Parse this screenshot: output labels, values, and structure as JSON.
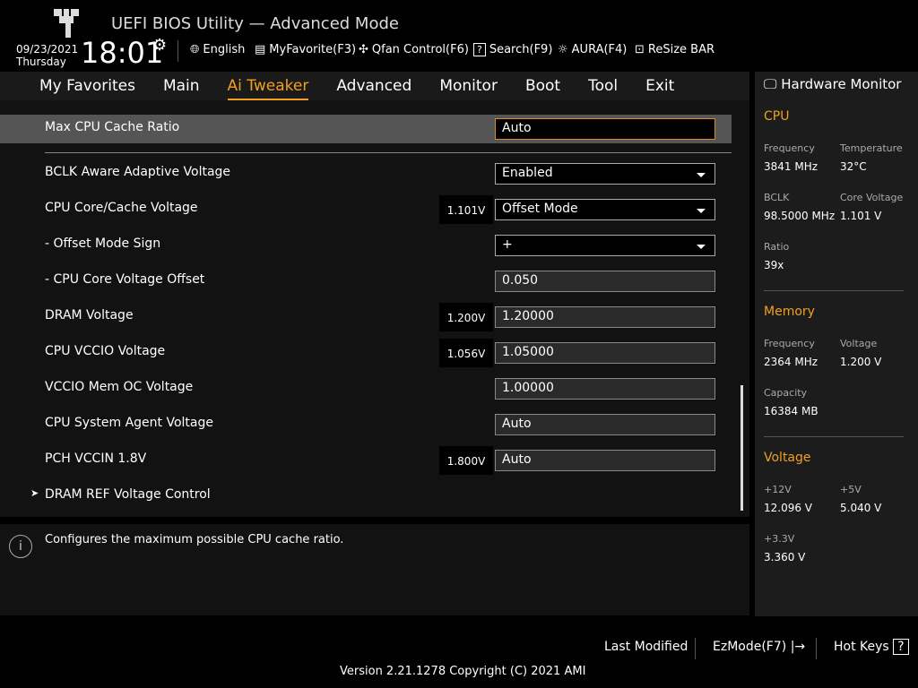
{
  "header": {
    "title": "UEFI BIOS Utility — Advanced Mode",
    "date": "09/23/2021",
    "day": "Thursday",
    "time": "18:01",
    "toolbar": [
      {
        "icon": "globe-icon",
        "label": "English"
      },
      {
        "icon": "favorite-icon",
        "label": "MyFavorite(F3)"
      },
      {
        "icon": "fan-icon",
        "label": "Qfan Control(F6)"
      },
      {
        "icon": "search-icon",
        "label": "Search(F9)"
      },
      {
        "icon": "aura-icon",
        "label": "AURA(F4)"
      },
      {
        "icon": "resize-bar-icon",
        "label": "ReSize BAR"
      }
    ]
  },
  "nav": {
    "tabs": [
      "My Favorites",
      "Main",
      "Ai Tweaker",
      "Advanced",
      "Monitor",
      "Boot",
      "Tool",
      "Exit"
    ],
    "active": "Ai Tweaker"
  },
  "settings": [
    {
      "label": "Max CPU Cache Ratio",
      "value": "Auto",
      "type": "input-selected"
    },
    {
      "label": "BCLK Aware Adaptive Voltage",
      "value": "Enabled",
      "type": "dropdown"
    },
    {
      "label": "CPU Core/Cache Voltage",
      "volt": "1.101V",
      "value": "Offset Mode",
      "type": "dropdown"
    },
    {
      "label": "- Offset Mode Sign",
      "value": "+",
      "type": "dropdown"
    },
    {
      "label": "- CPU Core Voltage Offset",
      "value": "0.050",
      "type": "input"
    },
    {
      "label": "DRAM Voltage",
      "volt": "1.200V",
      "value": "1.20000",
      "type": "input"
    },
    {
      "label": "CPU VCCIO Voltage",
      "volt": "1.056V",
      "value": "1.05000",
      "type": "input"
    },
    {
      "label": "VCCIO Mem OC Voltage",
      "value": "1.00000",
      "type": "input"
    },
    {
      "label": "CPU System Agent Voltage",
      "value": "Auto",
      "type": "input"
    },
    {
      "label": "PCH VCCIN 1.8V",
      "volt": "1.800V",
      "value": "Auto",
      "type": "input"
    },
    {
      "label": "DRAM REF Voltage Control",
      "type": "submenu"
    }
  ],
  "help": "Configures the maximum possible CPU cache ratio.",
  "hw": {
    "title": "Hardware Monitor",
    "cpu": {
      "h": "CPU",
      "freq_l": "Frequency",
      "freq": "3841 MHz",
      "temp_l": "Temperature",
      "temp": "32°C",
      "bclk_l": "BCLK",
      "bclk": "98.5000 MHz",
      "cv_l": "Core Voltage",
      "cv": "1.101 V",
      "ratio_l": "Ratio",
      "ratio": "39x"
    },
    "mem": {
      "h": "Memory",
      "freq_l": "Frequency",
      "freq": "2364 MHz",
      "v_l": "Voltage",
      "v": "1.200 V",
      "cap_l": "Capacity",
      "cap": "16384 MB"
    },
    "volt": {
      "h": "Voltage",
      "v12_l": "+12V",
      "v12": "12.096 V",
      "v5_l": "+5V",
      "v5": "5.040 V",
      "v33_l": "+3.3V",
      "v33": "3.360 V"
    }
  },
  "footer": {
    "last_modified": "Last Modified",
    "ezmode": "EzMode(F7)",
    "hotkeys": "Hot Keys",
    "version": "Version 2.21.1278 Copyright (C) 2021 AMI"
  },
  "colors": {
    "accent": "#f0a020"
  }
}
